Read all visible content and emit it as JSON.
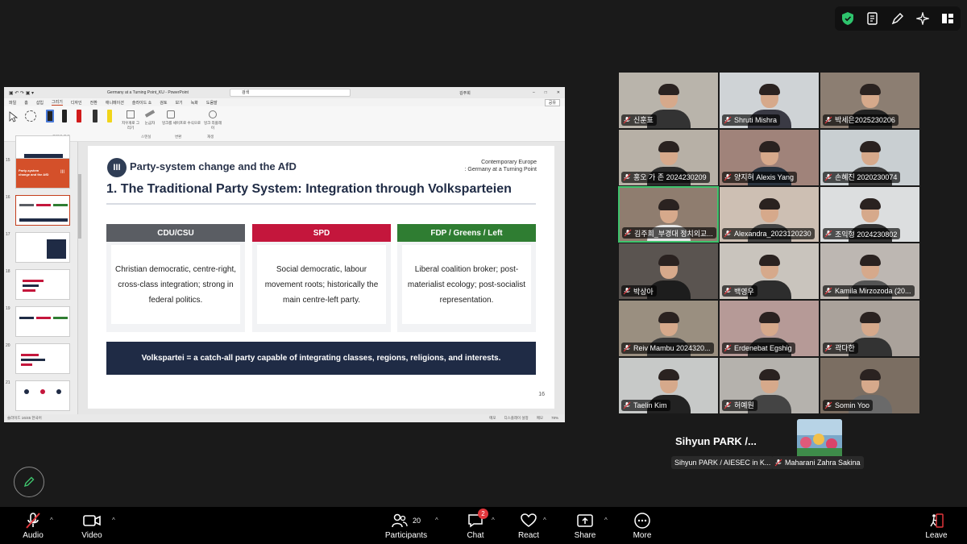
{
  "ppt": {
    "doc_title": "Germany at a Turning Point_KU  -  PowerPoint",
    "search": "검색",
    "user": "김주희",
    "menu": [
      "파일",
      "홈",
      "삽입",
      "그리기",
      "디자인",
      "전환",
      "애니메이션",
      "슬라이드 쇼",
      "검토",
      "보기",
      "녹화",
      "도움말"
    ],
    "share": "공유",
    "ribbon_groups": [
      "그리기 도구",
      "스텐실",
      "변환",
      "재생"
    ],
    "ribbon_labels": [
      "지우개로 그리기",
      "눈금자",
      "잉크를 셰이프로 수식으로",
      "잉크 리플레이"
    ],
    "status_left": "슬라이드 16/45   한국어",
    "status_right": [
      "메모",
      "디스플레이 설정",
      "메모",
      "78%"
    ],
    "thumb_numbers": [
      "15",
      "16",
      "17",
      "18",
      "19",
      "20",
      "21"
    ],
    "thumb15_text": "Party-system change and the AfD"
  },
  "slide": {
    "badge": "III",
    "section": "Party-system change and the AfD",
    "corner_line1": "Contemporary Europe",
    "corner_line2": ": Germany at a Turning Point",
    "title": "1. The Traditional Party System: Integration through Volksparteien",
    "columns": [
      {
        "head": "CDU/CSU",
        "body": "Christian democratic, centre-right, cross-class integration; strong in federal politics.",
        "color": "#5a5d63"
      },
      {
        "head": "SPD",
        "body": "Social democratic, labour movement roots; historically the main centre-left party.",
        "color": "#c4163c"
      },
      {
        "head": "FDP / Greens / Left",
        "body": "Liberal coalition broker; post-materialist ecology; post-socialist representation.",
        "color": "#2f7d32"
      }
    ],
    "banner": "Volkspartei = a catch-all party capable of integrating classes, regions, religions, and interests.",
    "page": "16"
  },
  "gallery": [
    "신훈표",
    "Shruti Mishra",
    "박세은2025230206",
    "홍오 가 존 2024230209",
    "양지혀 Alexis Yang",
    "손혜진 2020230074",
    "김주희_부경대 정치외교...",
    "Alexandra_2023120230",
    "조익형 2024230802",
    "박상아",
    "백영우",
    "Kamila Mirzozoda (20...",
    "Reiv Mambu 2024320...",
    "Erdenebat Egshig",
    "곽다한",
    "Taelin Kim",
    "허예원",
    "Somin Yoo"
  ],
  "self_name": "Sihyun PARK /...",
  "self_tag": "Sihyun PARK / AIESEC in K...",
  "other_tag": "Maharani Zahra Sakina",
  "toolbar": {
    "audio": "Audio",
    "video": "Video",
    "participants": "Participants",
    "participants_count": "20",
    "chat": "Chat",
    "chat_badge": "2",
    "react": "React",
    "share": "Share",
    "more": "More",
    "leave": "Leave"
  },
  "colors": {
    "navy": "#1f2b45",
    "speaker_border": "#3ec46d",
    "muted_red": "#e0353b"
  }
}
